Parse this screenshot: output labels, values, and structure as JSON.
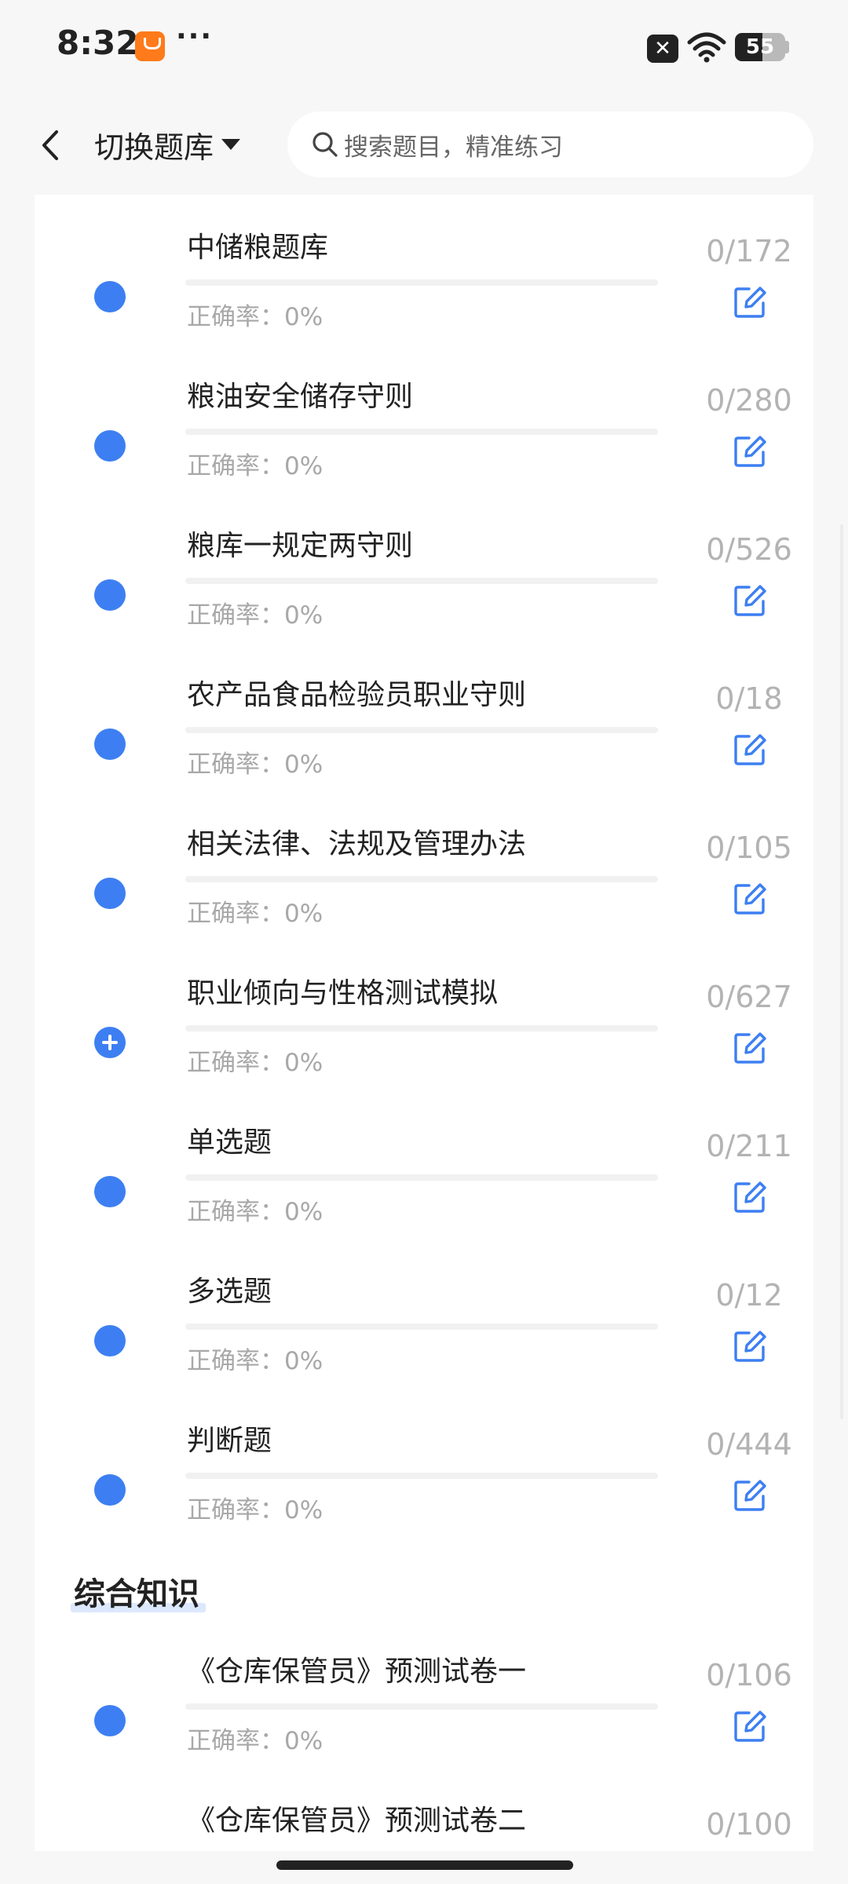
{
  "status_bar": {
    "time": "8:32",
    "more": "···",
    "notification": "✕",
    "battery": "55",
    "battery_level": 0.55
  },
  "nav": {
    "switch_bank_label": "切换题库",
    "search_placeholder": "搜索题目，精准练习"
  },
  "colors": {
    "accent": "#3d7ff2",
    "muted": "#a8a8a8"
  },
  "items": [
    {
      "title": "中储粮题库",
      "accuracy": "正确率：0%",
      "count": "0/172",
      "icon": "dot",
      "progress": 0
    },
    {
      "title": "粮油安全储存守则",
      "accuracy": "正确率：0%",
      "count": "0/280",
      "icon": "dot",
      "progress": 0
    },
    {
      "title": "粮库一规定两守则",
      "accuracy": "正确率：0%",
      "count": "0/526",
      "icon": "dot",
      "progress": 0
    },
    {
      "title": "农产品食品检验员职业守则",
      "accuracy": "正确率：0%",
      "count": "0/18",
      "icon": "dot",
      "progress": 0
    },
    {
      "title": "相关法律、法规及管理办法",
      "accuracy": "正确率：0%",
      "count": "0/105",
      "icon": "dot",
      "progress": 0
    },
    {
      "title": "职业倾向与性格测试模拟",
      "accuracy": "正确率：0%",
      "count": "0/627",
      "icon": "plus",
      "progress": 0
    },
    {
      "title": "单选题",
      "accuracy": "正确率：0%",
      "count": "0/211",
      "icon": "dot",
      "progress": 0
    },
    {
      "title": "多选题",
      "accuracy": "正确率：0%",
      "count": "0/12",
      "icon": "dot",
      "progress": 0
    },
    {
      "title": "判断题",
      "accuracy": "正确率：0%",
      "count": "0/444",
      "icon": "dot",
      "progress": 0
    }
  ],
  "section": {
    "title": "综合知识",
    "items": [
      {
        "title": "《仓库保管员》预测试卷一",
        "accuracy": "正确率：0%",
        "count": "0/106",
        "icon": "dot",
        "progress": 0
      },
      {
        "title": "《仓库保管员》预测试卷二",
        "accuracy": "",
        "count": "0/100",
        "icon": "dot",
        "progress": 0
      }
    ]
  }
}
